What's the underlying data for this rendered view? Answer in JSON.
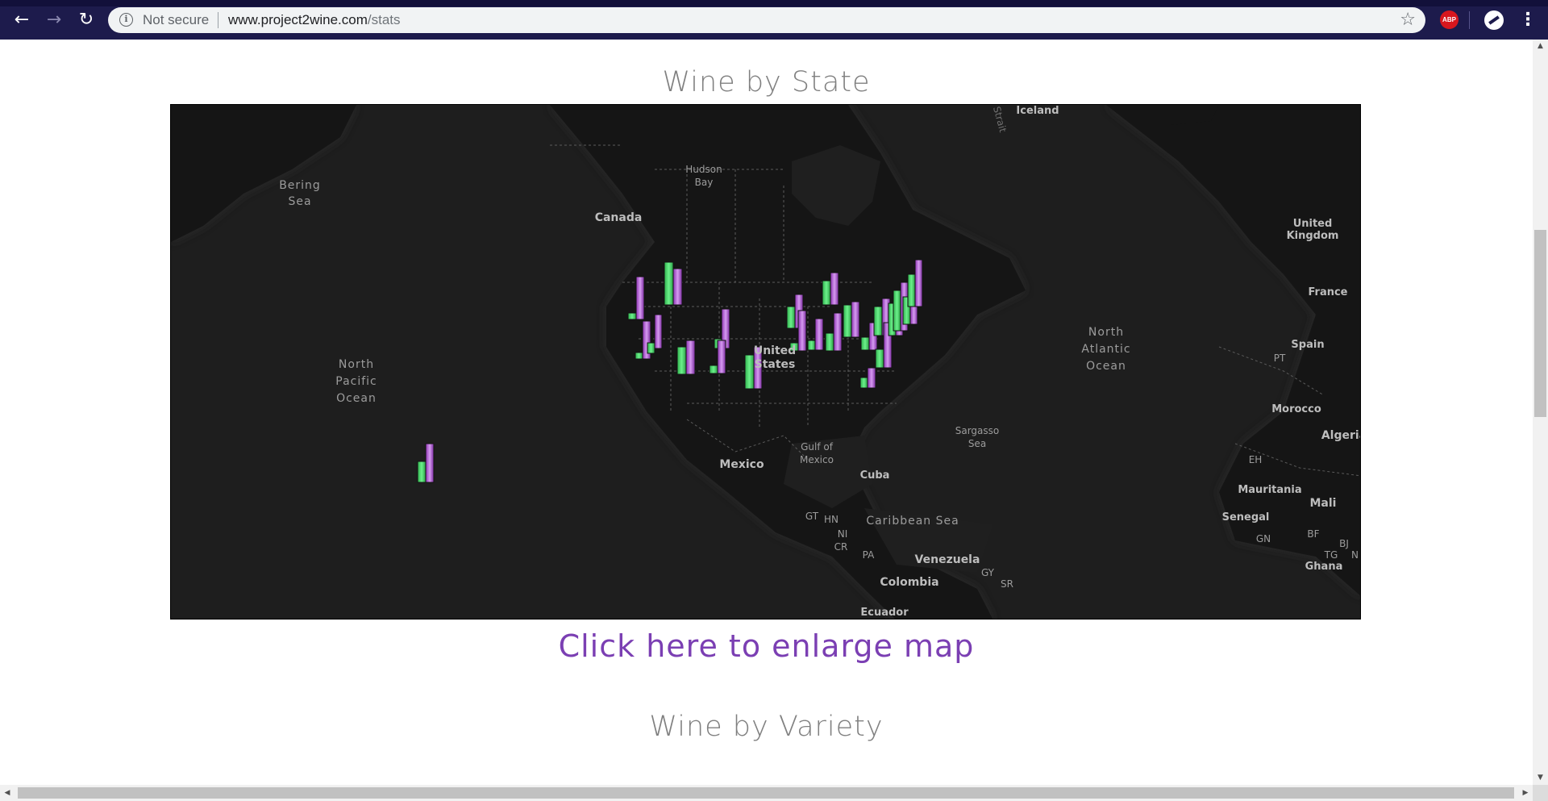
{
  "browser": {
    "security_label": "Not secure",
    "url_host": "www.project2wine.com",
    "url_path": "/stats",
    "extension_abp_label": "ABP",
    "icons": [
      "back-arrow-icon",
      "forward-arrow-icon",
      "reload-icon",
      "info-icon",
      "star-icon",
      "adblock-icon",
      "profile-icon",
      "menu-dots-icon"
    ]
  },
  "page": {
    "state_title": "Wine by State",
    "enlarge_link": "Click here to enlarge map",
    "variety_title": "Wine by Variety"
  },
  "map": {
    "style": "dark basemap",
    "series_colors": [
      "#3ecf5f",
      "#a44fc8"
    ],
    "labels": {
      "bering_sea": "Bering\nSea",
      "hudson_bay": "Hudson\nBay",
      "canada": "Canada",
      "iceland": "Iceland",
      "united_kingdom": "United\nKingdom",
      "france": "France",
      "spain": "Spain",
      "pt": "PT",
      "morocco": "Morocco",
      "algeria": "Algeria",
      "eh": "EH",
      "mauritania": "Mauritania",
      "mali": "Mali",
      "senegal": "Senegal",
      "gn": "GN",
      "bf": "BF",
      "bj": "BJ",
      "tg": "TG",
      "ghana": "Ghana",
      "n_label": "N",
      "north_pacific_ocean": "North\nPacific\nOcean",
      "north_atlantic_ocean": "North\nAtlantic\nOcean",
      "united_states": "United\nStates",
      "sargasso_sea": "Sargasso\nSea",
      "gulf_of_mexico": "Gulf of\nMexico",
      "mexico": "Mexico",
      "cuba": "Cuba",
      "caribbean_sea": "Caribbean Sea",
      "gt": "GT",
      "hn": "HN",
      "ni": "NI",
      "cr": "CR",
      "pa": "PA",
      "venezuela": "Venezuela",
      "colombia": "Colombia",
      "gy": "GY",
      "sr": "SR",
      "ecuador": "Ecuador",
      "strait": "Strait"
    }
  }
}
